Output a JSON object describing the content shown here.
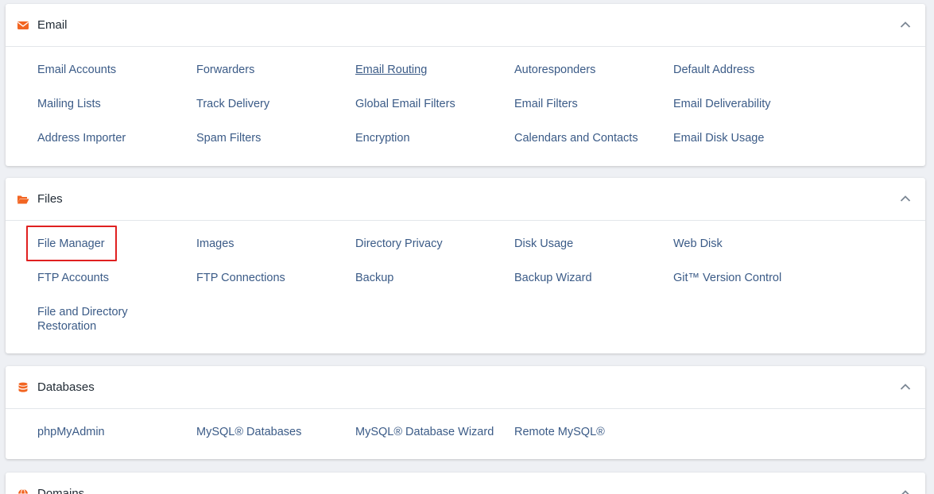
{
  "colors": {
    "accent": "#f26522",
    "link": "#3b5b87",
    "highlight": "#e02020"
  },
  "email": {
    "title": "Email",
    "icon": "envelope-icon",
    "items": [
      "Email Accounts",
      "Forwarders",
      "Email Routing",
      "Autoresponders",
      "Default Address",
      "Mailing Lists",
      "Track Delivery",
      "Global Email Filters",
      "Email Filters",
      "Email Deliverability",
      "Address Importer",
      "Spam Filters",
      "Encryption",
      "Calendars and Contacts",
      "Email Disk Usage"
    ]
  },
  "files": {
    "title": "Files",
    "icon": "folder-open-icon",
    "items": [
      "File Manager",
      "Images",
      "Directory Privacy",
      "Disk Usage",
      "Web Disk",
      "FTP Accounts",
      "FTP Connections",
      "Backup",
      "Backup Wizard",
      "Git™ Version Control",
      "File and Directory Restoration"
    ]
  },
  "databases": {
    "title": "Databases",
    "icon": "database-icon",
    "items": [
      "phpMyAdmin",
      "MySQL® Databases",
      "MySQL® Database Wizard",
      "Remote MySQL®"
    ]
  },
  "domains": {
    "title": "Domains",
    "icon": "globe-icon"
  }
}
